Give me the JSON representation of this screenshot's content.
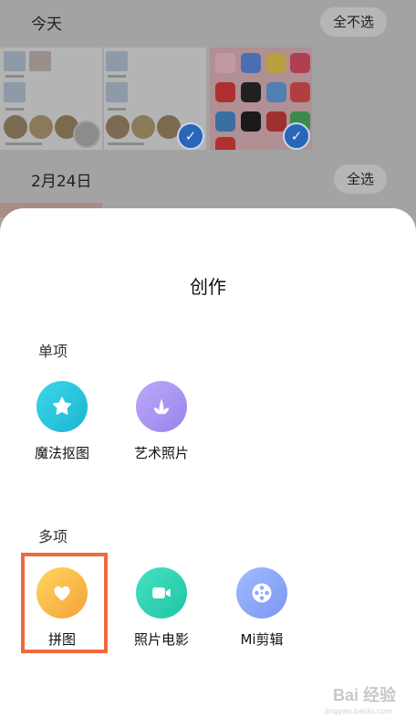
{
  "gallery": {
    "sections": [
      {
        "date": "今天",
        "action": "全不选"
      },
      {
        "date": "2月24日",
        "action": "全选"
      }
    ]
  },
  "sheet": {
    "title": "创作",
    "single_label": "单项",
    "multi_label": "多项",
    "single_tools": [
      {
        "label": "魔法抠图",
        "icon": "star-icon",
        "color_from": "#38d4e4",
        "color_to": "#1fb8d6"
      },
      {
        "label": "艺术照片",
        "icon": "leaf-icon",
        "color_from": "#b9a4f6",
        "color_to": "#9a86ef"
      }
    ],
    "multi_tools": [
      {
        "label": "拼图",
        "icon": "heart-icon",
        "color_from": "#ffd25a",
        "color_to": "#f4a63c"
      },
      {
        "label": "照片电影",
        "icon": "video-icon",
        "color_from": "#3ee0c0",
        "color_to": "#22c7a6"
      },
      {
        "label": "Mi剪辑",
        "icon": "film-reel-icon",
        "color_from": "#9cb6fb",
        "color_to": "#7d99f4"
      }
    ],
    "highlight_color": "#ef6a3a"
  },
  "watermark": {
    "text": "Bai 经验",
    "sub": "jingyan.baidu.com"
  }
}
